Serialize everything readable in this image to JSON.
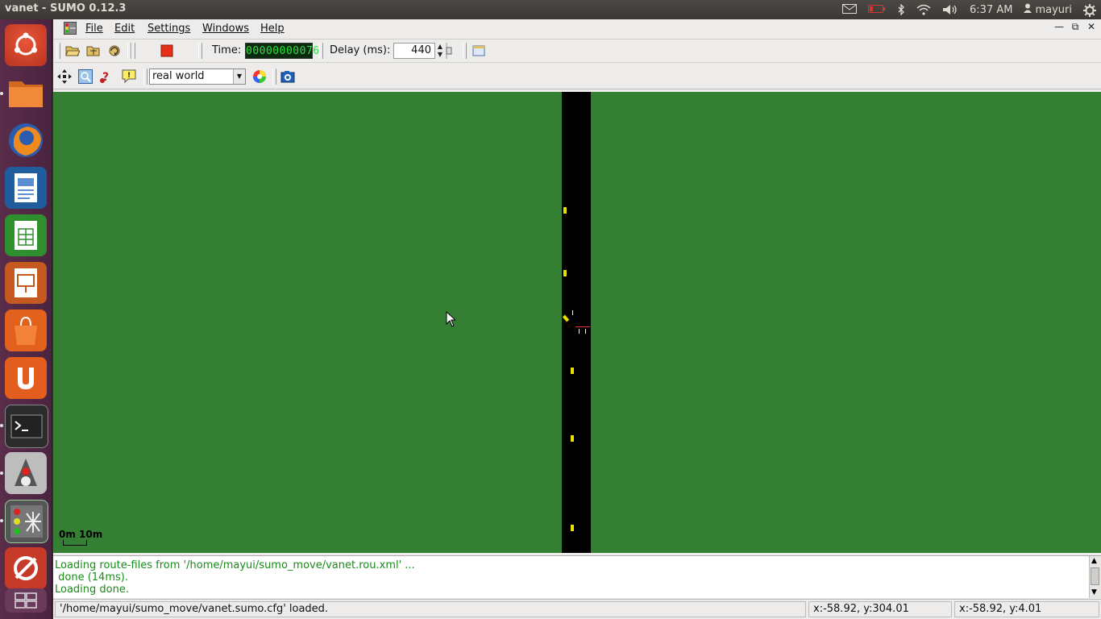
{
  "panel": {
    "window_title": "vanet - SUMO 0.12.3",
    "clock": "6:37 AM",
    "user": "mayuri"
  },
  "menu": {
    "file": "File",
    "edit": "Edit",
    "settings": "Settings",
    "windows": "Windows",
    "help": "Help"
  },
  "toolbar": {
    "time_label": "Time:",
    "time_value": "00000000076",
    "delay_label": "Delay (ms):",
    "delay_value": "440"
  },
  "view": {
    "scheme_selected": "real world"
  },
  "canvas": {
    "scale_label": "0m  10m",
    "vehicle_count": 7
  },
  "messages": [
    "Loading route-files from '/home/mayui/sumo_move/vanet.rou.xml' ...",
    " done (14ms).",
    "Loading done."
  ],
  "status": {
    "message": "'/home/mayui/sumo_move/vanet.sumo.cfg' loaded.",
    "coords_net": "x:-58.92, y:304.01",
    "coords_geo": "x:-58.92, y:4.01"
  },
  "colors": {
    "canvas_bg": "#357f34",
    "road": "#000000",
    "vehicle": "#e8e000",
    "log_text": "#1a8a1a"
  }
}
